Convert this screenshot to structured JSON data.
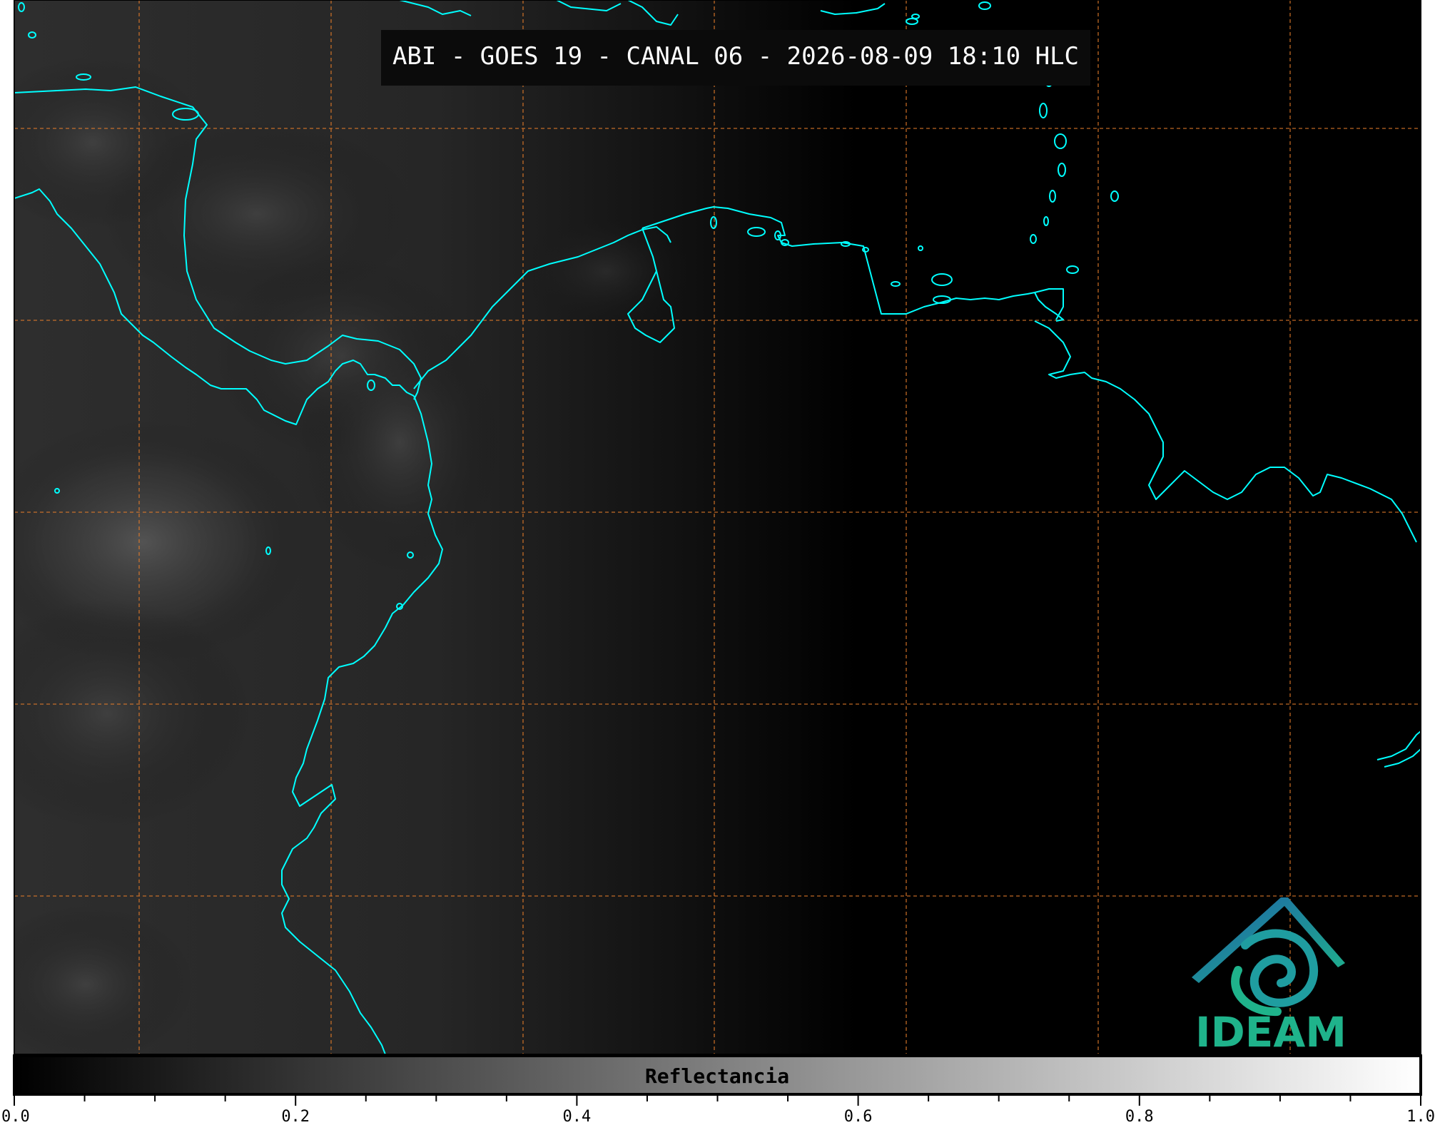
{
  "title": "ABI - GOES 19 - CANAL 06 - 2026-08-09 18:10 HLC",
  "colorbar": {
    "label": "Reflectancia",
    "min": 0.0,
    "max": 1.0,
    "ticks": [
      "0.0",
      "0.2",
      "0.4",
      "0.6",
      "0.8",
      "1.0"
    ],
    "colormap": [
      "#000000",
      "#ffffff"
    ]
  },
  "logo": {
    "text": "IDEAM",
    "colors": [
      "#1e62a8",
      "#1fb38b",
      "#2a8fb0"
    ]
  },
  "colors": {
    "coastline": "#00ffff",
    "gridlines": "#e07a2a",
    "background": "#000000",
    "title_box": "#0b0b0b"
  }
}
